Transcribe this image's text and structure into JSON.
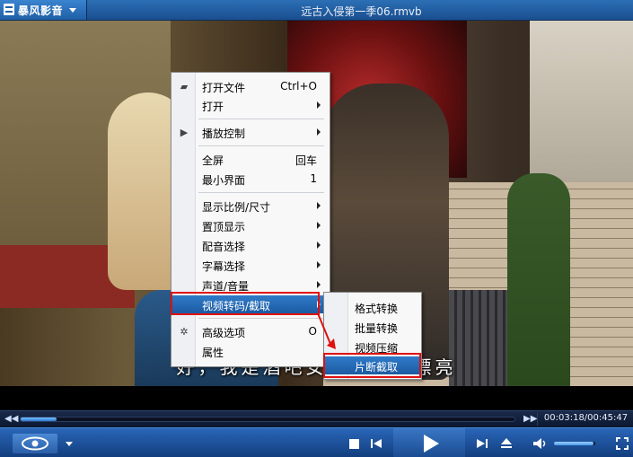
{
  "app": {
    "name": "暴风影音",
    "window_title": "远古入侵第一季06.rmvb"
  },
  "video": {
    "subtitle": "好，我是酒吧女郎，我很漂亮"
  },
  "context_menu": {
    "items": [
      {
        "label": "打开文件",
        "shortcut": "Ctrl+O",
        "icon": "folder-icon"
      },
      {
        "label": "打开",
        "submenu": true
      },
      {
        "label": "播放控制",
        "submenu": true,
        "icon": "play-small-icon"
      },
      {
        "label": "全屏",
        "shortcut": "回车"
      },
      {
        "label": "最小界面",
        "shortcut": "1"
      },
      {
        "label": "显示比例/尺寸",
        "submenu": true
      },
      {
        "label": "置顶显示",
        "submenu": true
      },
      {
        "label": "配音选择",
        "submenu": true
      },
      {
        "label": "字幕选择",
        "submenu": true
      },
      {
        "label": "声道/音量",
        "submenu": true
      },
      {
        "label": "视频转码/截取",
        "submenu": true,
        "highlighted": true
      },
      {
        "label": "高级选项",
        "shortcut": "O",
        "icon": "gear-icon"
      },
      {
        "label": "属性"
      }
    ]
  },
  "submenu": {
    "items": [
      {
        "label": "格式转换"
      },
      {
        "label": "批量转换"
      },
      {
        "label": "视频压缩"
      },
      {
        "label": "片断截取",
        "highlighted": true
      }
    ]
  },
  "player": {
    "elapsed": "00:03:18",
    "total": "00:45:47",
    "time_text": "00:03:18/00:45:47",
    "progress": 0.072,
    "volume": 0.95
  },
  "icons": {
    "seek_back": "rewind-icon",
    "seek_forward": "fast-forward-icon",
    "stop": "stop-icon",
    "prev": "previous-icon",
    "play": "play-icon",
    "next": "next-icon",
    "eject": "eject-icon",
    "volume": "speaker-icon",
    "fullscreen": "fullscreen-icon",
    "eye": "eye-icon"
  },
  "colors": {
    "highlight": "#1c5ba2",
    "callout_red": "#e01010",
    "toolbar_blue": "#2a66b8"
  }
}
